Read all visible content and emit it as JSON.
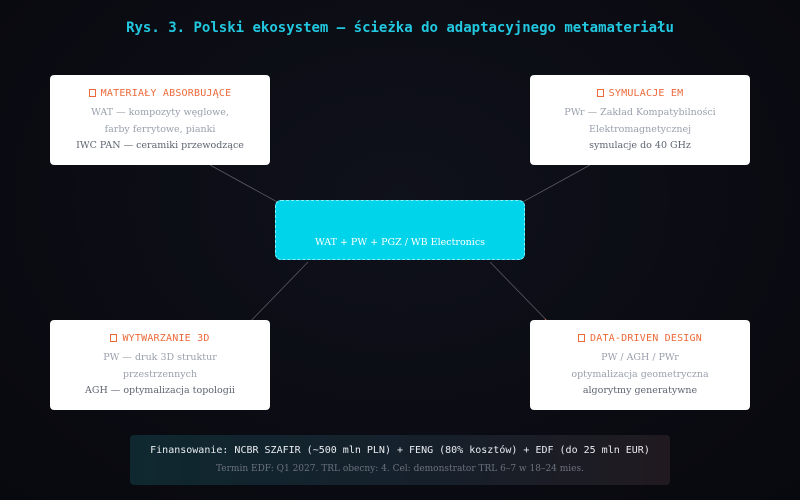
{
  "title": "Rys. 3. Polski ekosystem — ścieżka do adaptacyjnego metamateriału",
  "colors": {
    "accent_title": "#22c8e0",
    "hub_fill": "#00d4ea",
    "card_title": "#ec6a3a",
    "connector": "#5a5a60",
    "connector_highlight": "#ec6a3a"
  },
  "hub": {
    "label": "WAT + PW + PGZ / WB Electronics"
  },
  "cards": {
    "materials": {
      "icon": "square-icon",
      "title": "MATERIAŁY ABSORBUJĄCE",
      "line1": "WAT — kompozyty węglowe,",
      "line2": "farby ferrytowe, pianki",
      "line3": "IWC PAN — ceramiki przewodzące"
    },
    "simulation": {
      "icon": "square-icon",
      "title": "SYMULACJE EM",
      "line1": "PWr — Zakład Kompatybilności",
      "line2": "Elektromagnetycznej",
      "line3": "symulacje do 40 GHz"
    },
    "printing": {
      "icon": "square-icon",
      "title": "WYTWARZANIE 3D",
      "line1": "PW — druk 3D struktur",
      "line2": "przestrzennych",
      "line3": "AGH — optymalizacja topologii"
    },
    "datadriven": {
      "icon": "square-icon",
      "title": "DATA-DRIVEN DESIGN",
      "line1": "PW / AGH / PWr",
      "line2": "optymalizacja geometryczna",
      "line3": "algorytmy generatywne"
    }
  },
  "funding": {
    "main": "Finansowanie: NCBR SZAFIR (~500 mln PLN) + FENG (80% kosztów) + EDF (do 25 mln EUR)",
    "sub": "Termin EDF: Q1 2027. TRL obecny: 4. Cel: demonstrator TRL 6–7 w 18–24 mies."
  }
}
